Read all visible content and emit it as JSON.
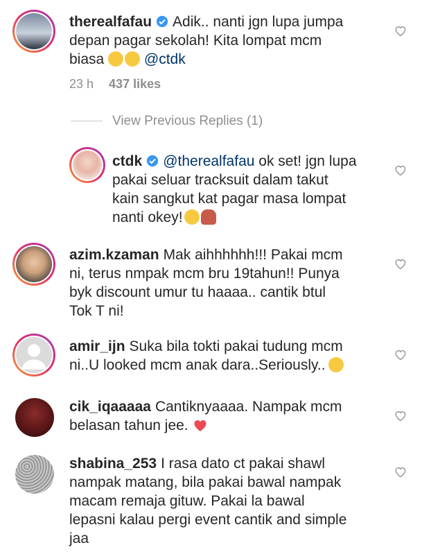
{
  "comments": [
    {
      "username": "therealfafau",
      "verified": true,
      "lines": [
        "Adik.. nanti jgn lupa jumpa",
        "depan pagar sekolah! Kita lompat mcm",
        "biasa"
      ],
      "mention": "@ctdk",
      "time": "23 h",
      "likes": "437 likes"
    },
    {
      "username": "ctdk",
      "verified": true,
      "mention": "@therealfafau",
      "lines": [
        "ok set! jgn lupa",
        "pakai seluar tracksuit dalam takut",
        "kain sangkut kat pagar masa lompat",
        "nanti okey!"
      ]
    },
    {
      "username": "azim.kzaman",
      "lines": [
        "Mak aihhhhhh!!! Pakai mcm",
        "ni, terus nmpak mcm bru 19tahun!! Punya",
        "byk discount umur tu haaaa.. cantik btul",
        "Tok T ni!"
      ]
    },
    {
      "username": "amir_ijn",
      "lines": [
        "Suka bila tokti pakai tudung mcm",
        "ni..U looked mcm anak dara..Seriously.."
      ]
    },
    {
      "username": "cik_iqaaaaa",
      "lines": [
        "Cantiknyaaaa. Nampak mcm",
        "belasan tahun jee."
      ]
    },
    {
      "username": "shabina_253",
      "lines": [
        "I rasa dato ct pakai shawl",
        "nampak matang, bila pakai bawal nampak",
        "macam remaja gituw. Pakai la bawal",
        "lepasni kalau pergi event cantik and simple",
        "jaa"
      ]
    }
  ],
  "view_previous_replies": "View Previous Replies (1)",
  "colors": {
    "verified": "#3897f0",
    "muted": "#8e8e8e",
    "mention": "#003569",
    "heart_red": "#ed4956"
  }
}
